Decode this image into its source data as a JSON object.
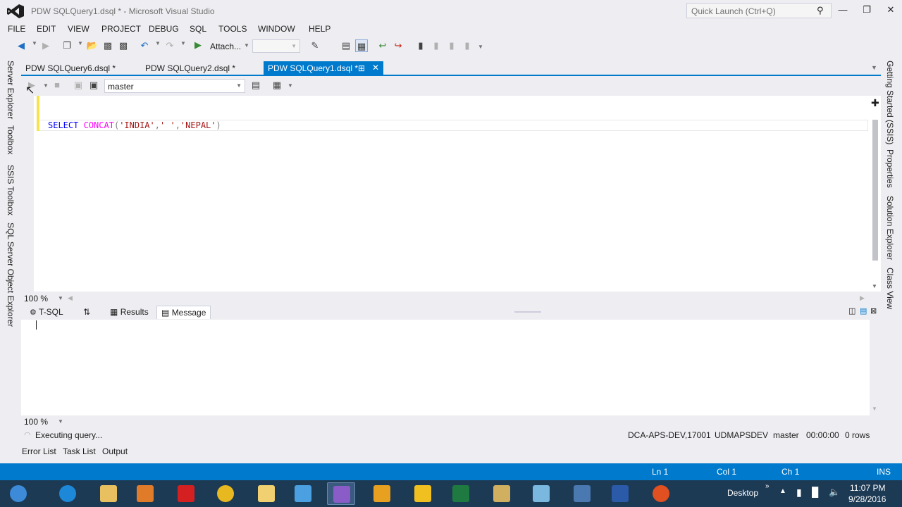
{
  "window": {
    "title": "PDW SQLQuery1.dsql * - Microsoft Visual Studio",
    "quick_launch_placeholder": "Quick Launch (Ctrl+Q)"
  },
  "menu": [
    "FILE",
    "EDIT",
    "VIEW",
    "PROJECT",
    "DEBUG",
    "SQL",
    "TOOLS",
    "WINDOW",
    "HELP"
  ],
  "toolbar": {
    "attach_label": "Attach..."
  },
  "left_rail": [
    "Server Explorer",
    "Toolbox",
    "SSIS Toolbox",
    "SQL Server Object Explorer"
  ],
  "right_rail": [
    "Getting Started (SSIS)",
    "Properties",
    "Solution Explorer",
    "Class View"
  ],
  "doc_tabs": [
    {
      "label": "PDW SQLQuery6.dsql *",
      "active": false
    },
    {
      "label": "PDW SQLQuery2.dsql *",
      "active": false
    },
    {
      "label": "PDW SQLQuery1.dsql *",
      "active": true
    }
  ],
  "editor_toolbar": {
    "database": "master"
  },
  "editor": {
    "code": {
      "kw": "SELECT",
      "fn": "CONCAT",
      "open": "(",
      "s1": "'INDIA'",
      "c1": ",",
      "s2": "' '",
      "c2": ",",
      "s3": "'NEPAL'",
      "close": ")"
    },
    "zoom": "100 %"
  },
  "results": {
    "tabs": [
      {
        "label": "T-SQL"
      },
      {
        "label": "Results"
      },
      {
        "label": "Message"
      }
    ],
    "zoom": "100 %"
  },
  "query_status": {
    "message": "Executing query...",
    "server": "DCA-APS-DEV,17001",
    "user": "UDMAPSDEV",
    "database": "master",
    "time": "00:00:00",
    "rows": "0 rows"
  },
  "bottom_tabs": [
    "Error List",
    "Task List",
    "Output"
  ],
  "statusbar": {
    "ln": "Ln 1",
    "col": "Col 1",
    "ch": "Ch 1",
    "mode": "INS"
  },
  "taskbar": {
    "desktop_label": "Desktop",
    "time": "11:07 PM",
    "date": "9/28/2016"
  },
  "colors": {
    "accent": "#007acc",
    "modified_gutter": "#f6e44a"
  }
}
